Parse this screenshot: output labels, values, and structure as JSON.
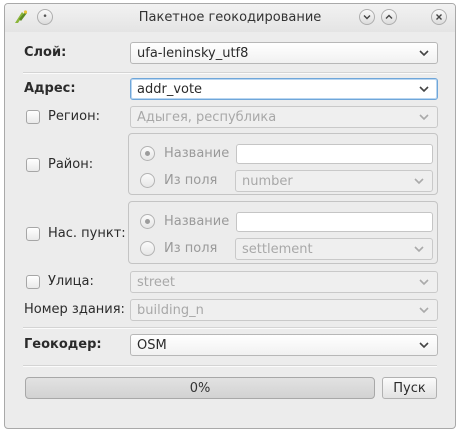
{
  "window": {
    "title": "Пакетное геокодирование"
  },
  "colors": {
    "focus_border": "#6fa6d9",
    "window_bg": "#ececec",
    "disabled_text": "#9a9a9a"
  },
  "layer": {
    "label": "Слой:",
    "value": "ufa-leninsky_utf8"
  },
  "address": {
    "label": "Адрес:",
    "value": "addr_vote"
  },
  "region": {
    "label": "Регион:",
    "checked": false,
    "value": "Адыгея, республика"
  },
  "district": {
    "label": "Район:",
    "checked": false,
    "name_option": "Название",
    "field_option": "Из поля",
    "name_value": "",
    "field_value": "number"
  },
  "settlement": {
    "label": "Нас. пункт:",
    "checked": false,
    "name_option": "Название",
    "field_option": "Из поля",
    "name_value": "",
    "field_value": "settlement"
  },
  "street": {
    "label": "Улица:",
    "checked": false,
    "value": "street"
  },
  "building": {
    "label": "Номер здания:",
    "value": "building_n"
  },
  "geocoder": {
    "label": "Геокодер:",
    "value": "OSM"
  },
  "progress": {
    "value": 0,
    "text": "0%"
  },
  "start_button": {
    "label": "Пуск"
  }
}
